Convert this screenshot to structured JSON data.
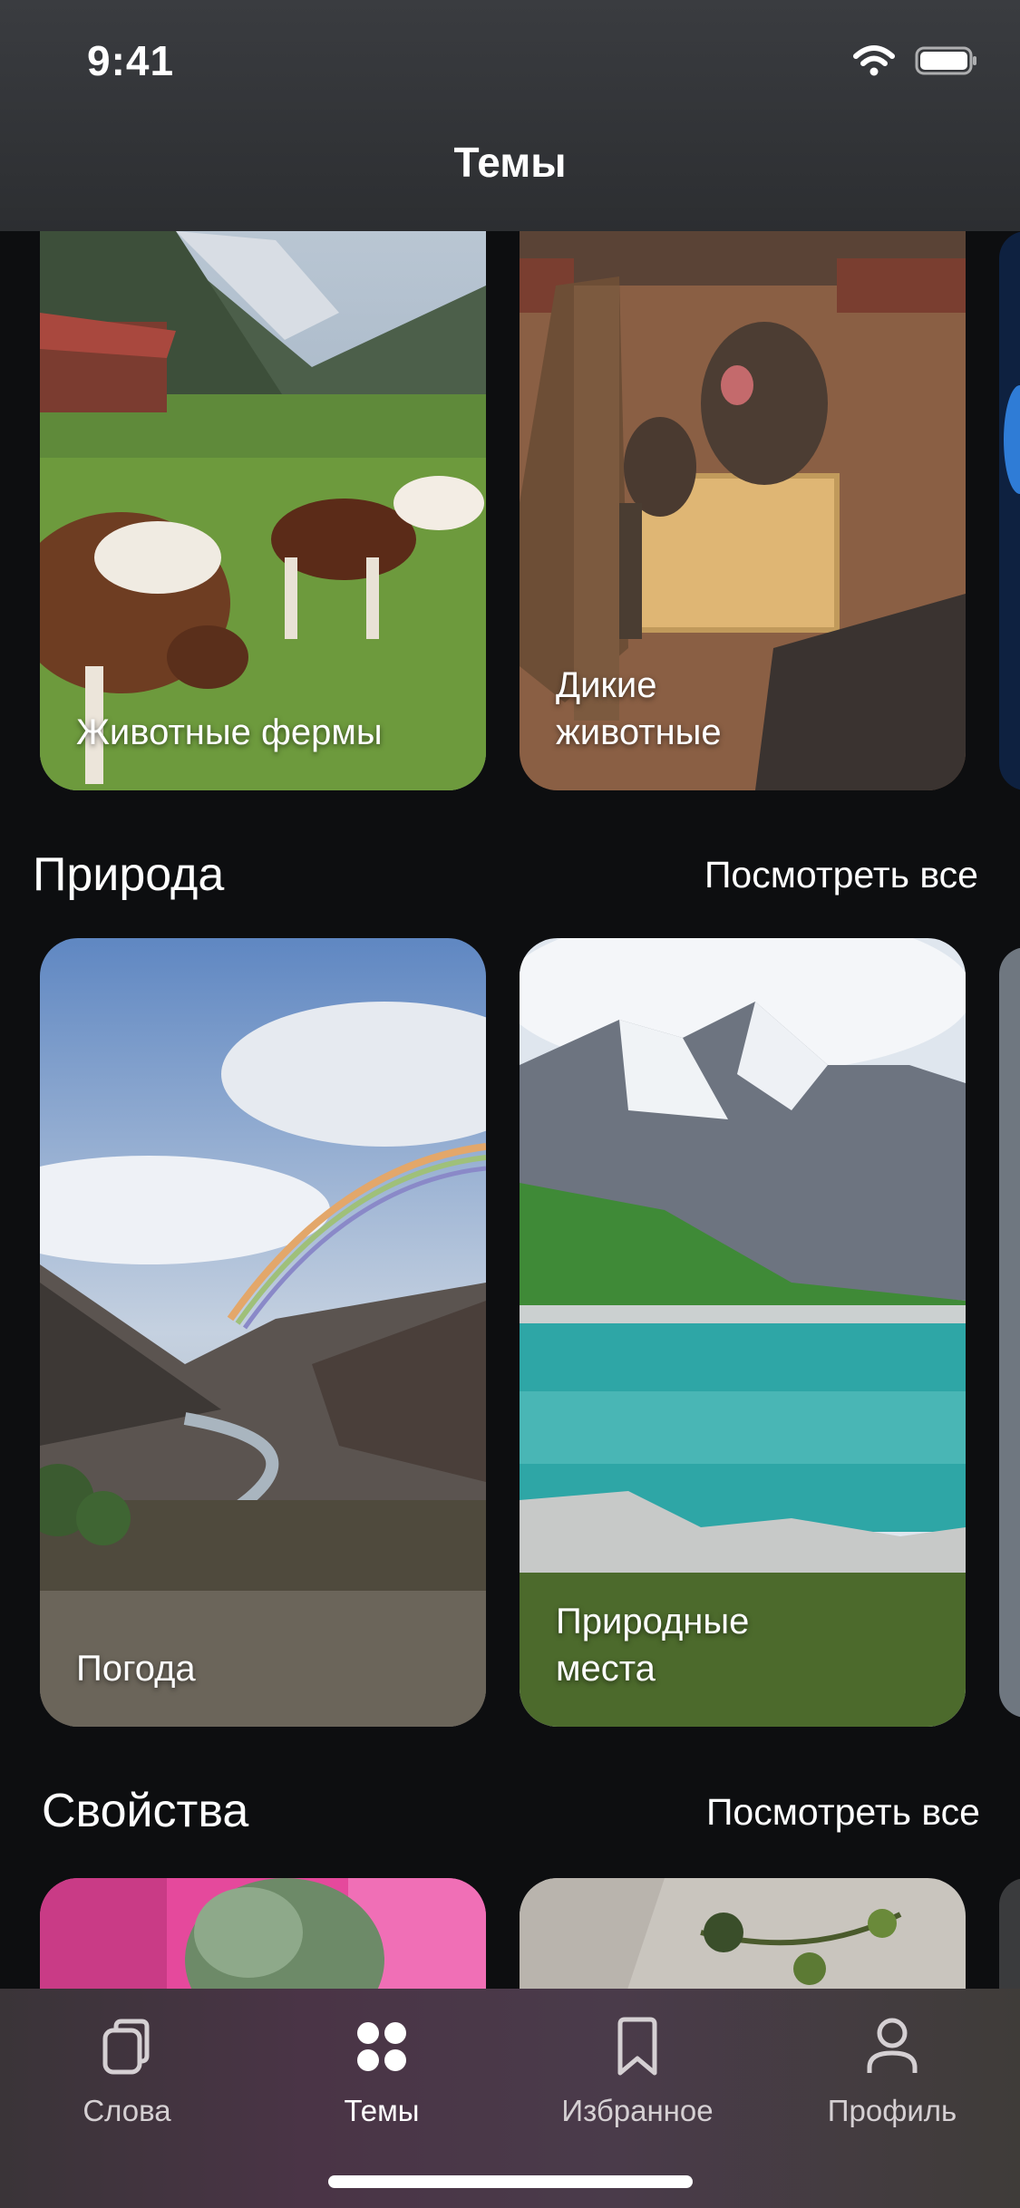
{
  "status": {
    "time": "9:41"
  },
  "nav": {
    "title": "Темы"
  },
  "top_row": {
    "cards": [
      {
        "label": "Животные фермы"
      },
      {
        "label": "Дикие животные"
      }
    ]
  },
  "nature": {
    "title": "Природа",
    "see_all": "Посмотреть все",
    "cards": [
      {
        "label": "Погода"
      },
      {
        "label": "Природные места"
      }
    ]
  },
  "properties": {
    "title": "Свойства",
    "see_all": "Посмотреть все"
  },
  "tabs": [
    {
      "label": "Слова",
      "icon": "cards-icon"
    },
    {
      "label": "Темы",
      "icon": "grid-dots-icon",
      "active": true
    },
    {
      "label": "Избранное",
      "icon": "bookmark-icon"
    },
    {
      "label": "Профиль",
      "icon": "person-icon"
    }
  ]
}
